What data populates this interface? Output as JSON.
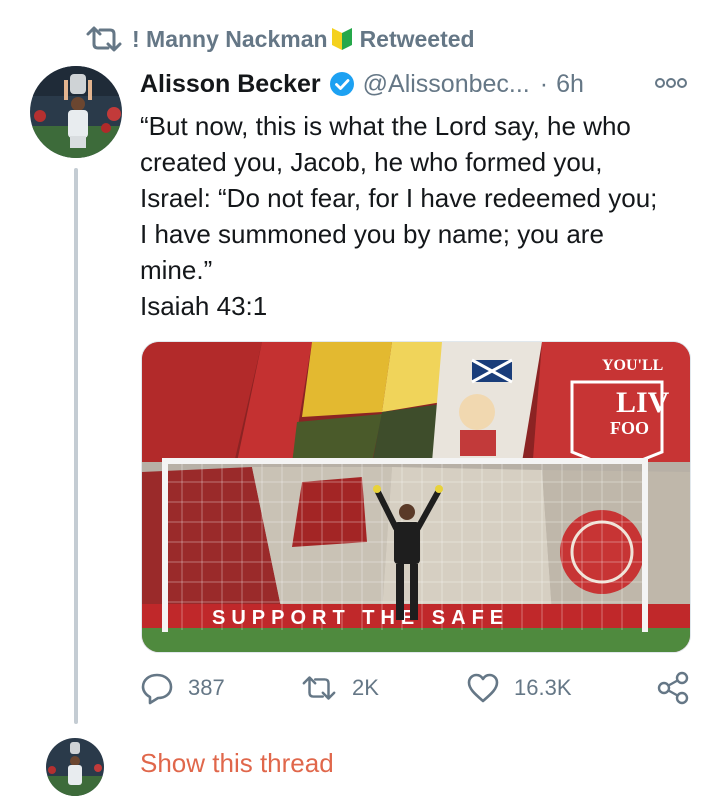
{
  "retweet_banner": {
    "icon": "retweet-icon",
    "retweeter_name": "! Manny Nackman",
    "badge_icon": "beginner-shield-icon",
    "label": "Retweeted"
  },
  "tweet": {
    "author": {
      "name": "Alisson Becker",
      "verified_icon": "verified-badge-icon",
      "handle": "@Alissonbec...",
      "separator": "·",
      "time": "6h"
    },
    "more_icon": "more-options-icon",
    "text_lines": [
      "“But now, this is what the Lord say, he who",
      "created you, Jacob, he who formed you,",
      "Israel: “Do not fear, for I have redeemed you;",
      "I have summoned you by name; you are",
      "mine.”",
      "Isaiah 43:1"
    ],
    "media": {
      "banner_texts": {
        "top_right_1": "YOU'LL",
        "top_right_2": "LIV",
        "top_right_3": "FOO",
        "hoarding": "SUPPORT THE SAFE"
      }
    },
    "actions": {
      "reply": {
        "icon": "reply-icon",
        "count": "387"
      },
      "retweet": {
        "icon": "retweet-icon",
        "count": "2K"
      },
      "like": {
        "icon": "heart-icon",
        "count": "16.3K"
      },
      "share": {
        "icon": "share-icon"
      }
    }
  },
  "thread": {
    "show_label": "Show this thread"
  },
  "colors": {
    "accent_link": "#e0674b",
    "secondary_text": "#657786",
    "verified_blue": "#1da1f2",
    "thread_line": "#c4ccd3"
  }
}
